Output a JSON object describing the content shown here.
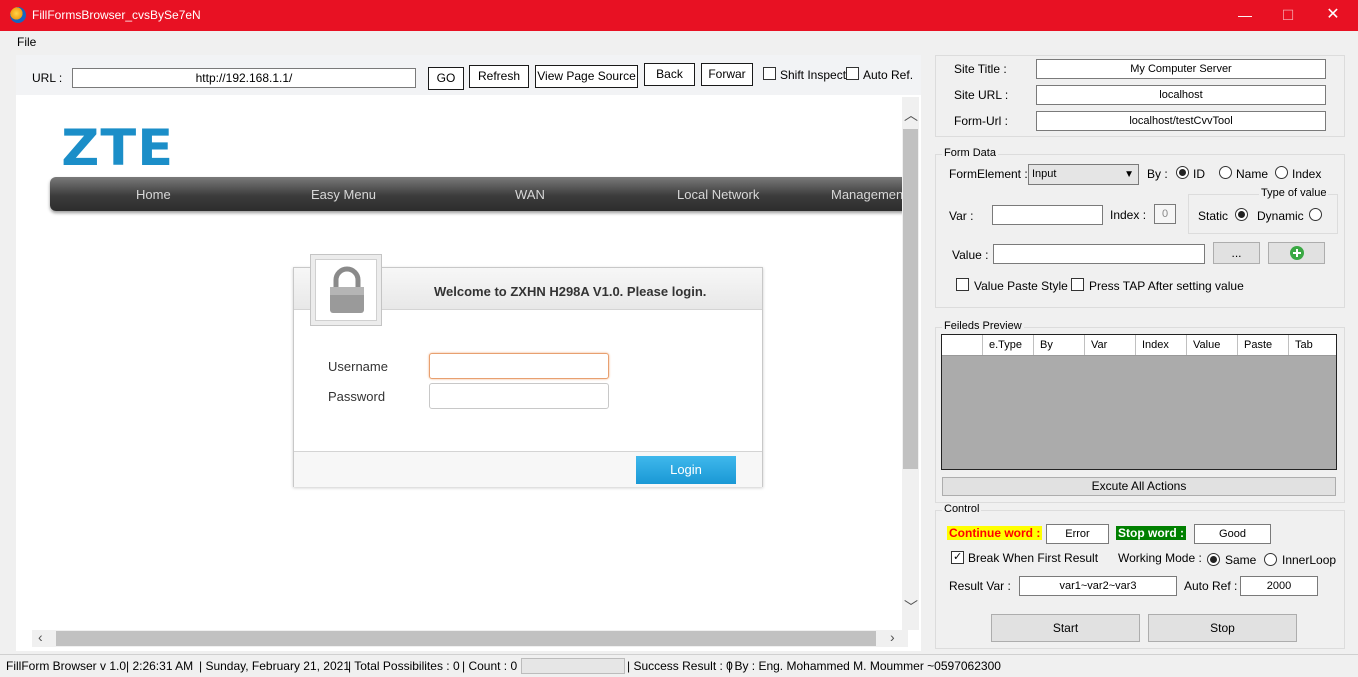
{
  "window": {
    "title": "FillFormsBrowser_cvsBySe7eN",
    "minimize": "—",
    "maximize": "☐",
    "close": "✕"
  },
  "menu": {
    "file": "File"
  },
  "urlbar": {
    "label": "URL :",
    "url": "http://192.168.1.1/",
    "go": "GO",
    "refresh": "Refresh",
    "view_source": "View Page Source",
    "back": "Back",
    "forward": "Forwar",
    "shift_inspect": "Shift Inspect",
    "auto_ref": "Auto Ref."
  },
  "page": {
    "logo": "ZTE",
    "nav": [
      "Home",
      "Easy Menu",
      "WAN",
      "Local Network",
      "Managemen"
    ],
    "login_title": "Welcome to ZXHN H298A V1.0. Please login.",
    "username_label": "Username",
    "password_label": "Password",
    "login_button": "Login"
  },
  "site": {
    "title_label": "Site Title :",
    "title_value": "My Computer Server",
    "url_label": "Site URL :",
    "url_value": "localhost",
    "form_url_label": "Form-Url :",
    "form_url_value": "localhost/testCvvTool"
  },
  "form_data": {
    "group": "Form Data",
    "element_label": "FormElement :",
    "element_value": "Input",
    "by_label": "By :",
    "by_options": [
      "ID",
      "Name",
      "Index"
    ],
    "by_selected": "ID",
    "type_of_value": "Type of value",
    "static": "Static",
    "dynamic": "Dynamic",
    "var_label": "Var :",
    "index_label": "Index :",
    "index_value": "0",
    "value_label": "Value :",
    "browse": "...",
    "value_paste_style": "Value Paste Style",
    "press_tap": "Press TAP After setting value"
  },
  "preview": {
    "group": "Feileds Preview",
    "columns": [
      "",
      "e.Type",
      "By",
      "Var",
      "Index",
      "Value",
      "Paste",
      "Tab"
    ],
    "execute": "Excute All Actions"
  },
  "control": {
    "group": "Control",
    "continue_word": "Continue word :",
    "continue_value": "Error",
    "stop_word": "Stop word :",
    "stop_value": "Good",
    "break_first": "Break When First Result",
    "working_mode": "Working Mode :",
    "same": "Same",
    "inner_loop": "InnerLoop",
    "result_var_label": "Result Var :",
    "result_var_value": "var1~var2~var3",
    "auto_ref_label": "Auto Ref :",
    "auto_ref_value": "2000",
    "start": "Start",
    "stop": "Stop"
  },
  "status": {
    "version": "FillForm Browser v 1.0",
    "time": "| 2:26:31 AM",
    "date": "| Sunday, February 21, 2021",
    "possibilities": "| Total Possibilites : 0",
    "count": "| Count : 0",
    "success": "| Success Result : 0",
    "by": "| By :  Eng. Mohammed M. Moummer ~0597062300"
  },
  "colors": {
    "titlebar": "#e81123",
    "accent_blue": "#1b8ec8",
    "continue_bg": "#ffff00",
    "continue_fg": "#ff0000",
    "stop_bg": "#008000",
    "stop_fg": "#ffffff"
  }
}
